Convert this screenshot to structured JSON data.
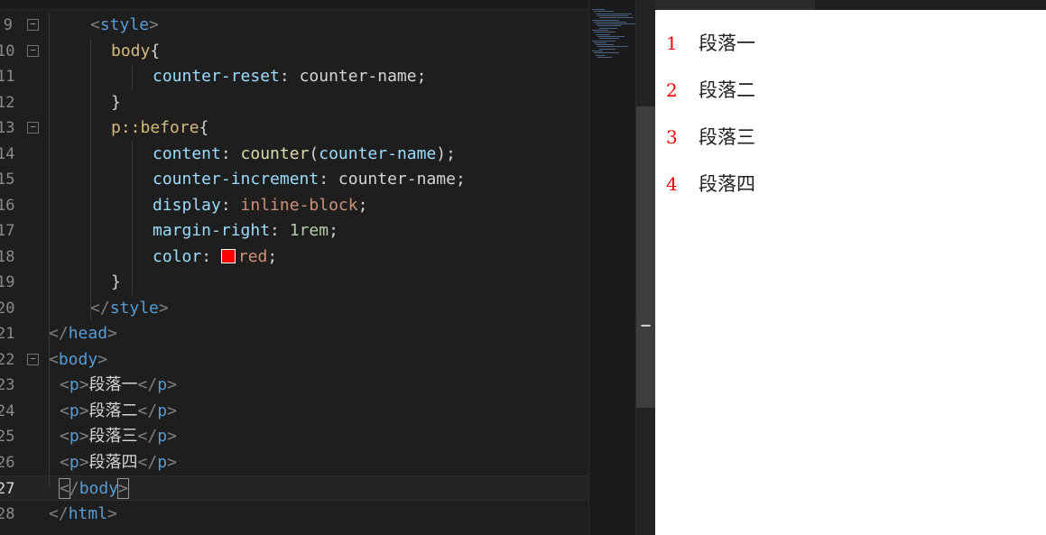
{
  "editor": {
    "lines": [
      {
        "num": "9",
        "fold": "−",
        "tokens": [
          [
            "t-br",
            "<"
          ],
          [
            "t-tag",
            "style"
          ],
          [
            "t-br",
            ">"
          ]
        ]
      },
      {
        "num": "10",
        "fold": "−",
        "tokens": [
          [
            "t-sel",
            "body"
          ],
          [
            "t-pun",
            "{"
          ]
        ]
      },
      {
        "num": "11",
        "fold": "",
        "tokens": [
          [
            "t-prop",
            "counter-reset"
          ],
          [
            "t-pun",
            ": counter-name;"
          ]
        ]
      },
      {
        "num": "12",
        "fold": "",
        "tokens": [
          [
            "t-pun",
            "}"
          ]
        ]
      },
      {
        "num": "13",
        "fold": "−",
        "tokens": [
          [
            "t-sel",
            "p::before"
          ],
          [
            "t-pun",
            "{"
          ]
        ]
      },
      {
        "num": "14",
        "fold": "",
        "tokens": [
          [
            "t-prop",
            "content"
          ],
          [
            "t-pun",
            ": "
          ],
          [
            "t-fn",
            "counter"
          ],
          [
            "t-pun",
            "("
          ],
          [
            "t-prop",
            "counter-name"
          ],
          [
            "t-pun",
            ");"
          ]
        ]
      },
      {
        "num": "15",
        "fold": "",
        "tokens": [
          [
            "t-prop",
            "counter-increment"
          ],
          [
            "t-pun",
            ": counter-name;"
          ]
        ]
      },
      {
        "num": "16",
        "fold": "",
        "tokens": [
          [
            "t-prop",
            "display"
          ],
          [
            "t-pun",
            ": "
          ],
          [
            "t-val",
            "inline-block"
          ],
          [
            "t-pun",
            ";"
          ]
        ]
      },
      {
        "num": "17",
        "fold": "",
        "tokens": [
          [
            "t-prop",
            "margin-right"
          ],
          [
            "t-pun",
            ": "
          ],
          [
            "t-num",
            "1rem"
          ],
          [
            "t-pun",
            ";"
          ]
        ]
      },
      {
        "num": "18",
        "fold": "",
        "tokens": [
          [
            "t-prop",
            "color"
          ],
          [
            "t-pun",
            ": "
          ],
          [
            "t-colorbox",
            ""
          ],
          [
            "t-val",
            "red"
          ],
          [
            "t-pun",
            ";"
          ]
        ]
      },
      {
        "num": "19",
        "fold": "",
        "tokens": [
          [
            "t-pun",
            "}"
          ]
        ]
      },
      {
        "num": "20",
        "fold": "",
        "tokens": [
          [
            "t-br",
            "</"
          ],
          [
            "t-tag",
            "style"
          ],
          [
            "t-br",
            ">"
          ]
        ]
      },
      {
        "num": "21",
        "fold": "",
        "tokens": [
          [
            "t-br",
            "</"
          ],
          [
            "t-tag",
            "head"
          ],
          [
            "t-br",
            ">"
          ]
        ]
      },
      {
        "num": "22",
        "fold": "−",
        "tokens": [
          [
            "t-br",
            "<"
          ],
          [
            "t-tag",
            "body"
          ],
          [
            "t-br",
            ">"
          ]
        ]
      },
      {
        "num": "23",
        "fold": "",
        "tokens": [
          [
            "t-br",
            "<"
          ],
          [
            "t-tag",
            "p"
          ],
          [
            "t-br",
            ">"
          ],
          [
            "t-txt",
            "段落一"
          ],
          [
            "t-br",
            "</"
          ],
          [
            "t-tag",
            "p"
          ],
          [
            "t-br",
            ">"
          ]
        ]
      },
      {
        "num": "24",
        "fold": "",
        "tokens": [
          [
            "t-br",
            "<"
          ],
          [
            "t-tag",
            "p"
          ],
          [
            "t-br",
            ">"
          ],
          [
            "t-txt",
            "段落二"
          ],
          [
            "t-br",
            "</"
          ],
          [
            "t-tag",
            "p"
          ],
          [
            "t-br",
            ">"
          ]
        ]
      },
      {
        "num": "25",
        "fold": "",
        "tokens": [
          [
            "t-br",
            "<"
          ],
          [
            "t-tag",
            "p"
          ],
          [
            "t-br",
            ">"
          ],
          [
            "t-txt",
            "段落三"
          ],
          [
            "t-br",
            "</"
          ],
          [
            "t-tag",
            "p"
          ],
          [
            "t-br",
            ">"
          ]
        ]
      },
      {
        "num": "26",
        "fold": "",
        "tokens": [
          [
            "t-br",
            "<"
          ],
          [
            "t-tag",
            "p"
          ],
          [
            "t-br",
            ">"
          ],
          [
            "t-txt",
            "段落四"
          ],
          [
            "t-br",
            "</"
          ],
          [
            "t-tag",
            "p"
          ],
          [
            "t-br",
            ">"
          ]
        ]
      },
      {
        "num": "27",
        "fold": "",
        "current": true,
        "tokens": [
          [
            "t-br t-match",
            "<"
          ],
          [
            "t-br",
            "/"
          ],
          [
            "t-tag",
            "body"
          ],
          [
            "t-br t-match",
            ">"
          ]
        ]
      },
      {
        "num": "28",
        "fold": "",
        "tokens": [
          [
            "t-br",
            "</"
          ],
          [
            "t-tag",
            "html"
          ],
          [
            "t-br",
            ">"
          ]
        ]
      }
    ]
  },
  "preview": {
    "accent_color": "#ff0000",
    "paragraphs": [
      {
        "num": "1",
        "text": "段落一"
      },
      {
        "num": "2",
        "text": "段落二"
      },
      {
        "num": "3",
        "text": "段落三"
      },
      {
        "num": "4",
        "text": "段落四"
      }
    ]
  },
  "scrollbar": {
    "marker_icon": "scroll-position-marker-icon",
    "marker_glyph": "▔"
  }
}
